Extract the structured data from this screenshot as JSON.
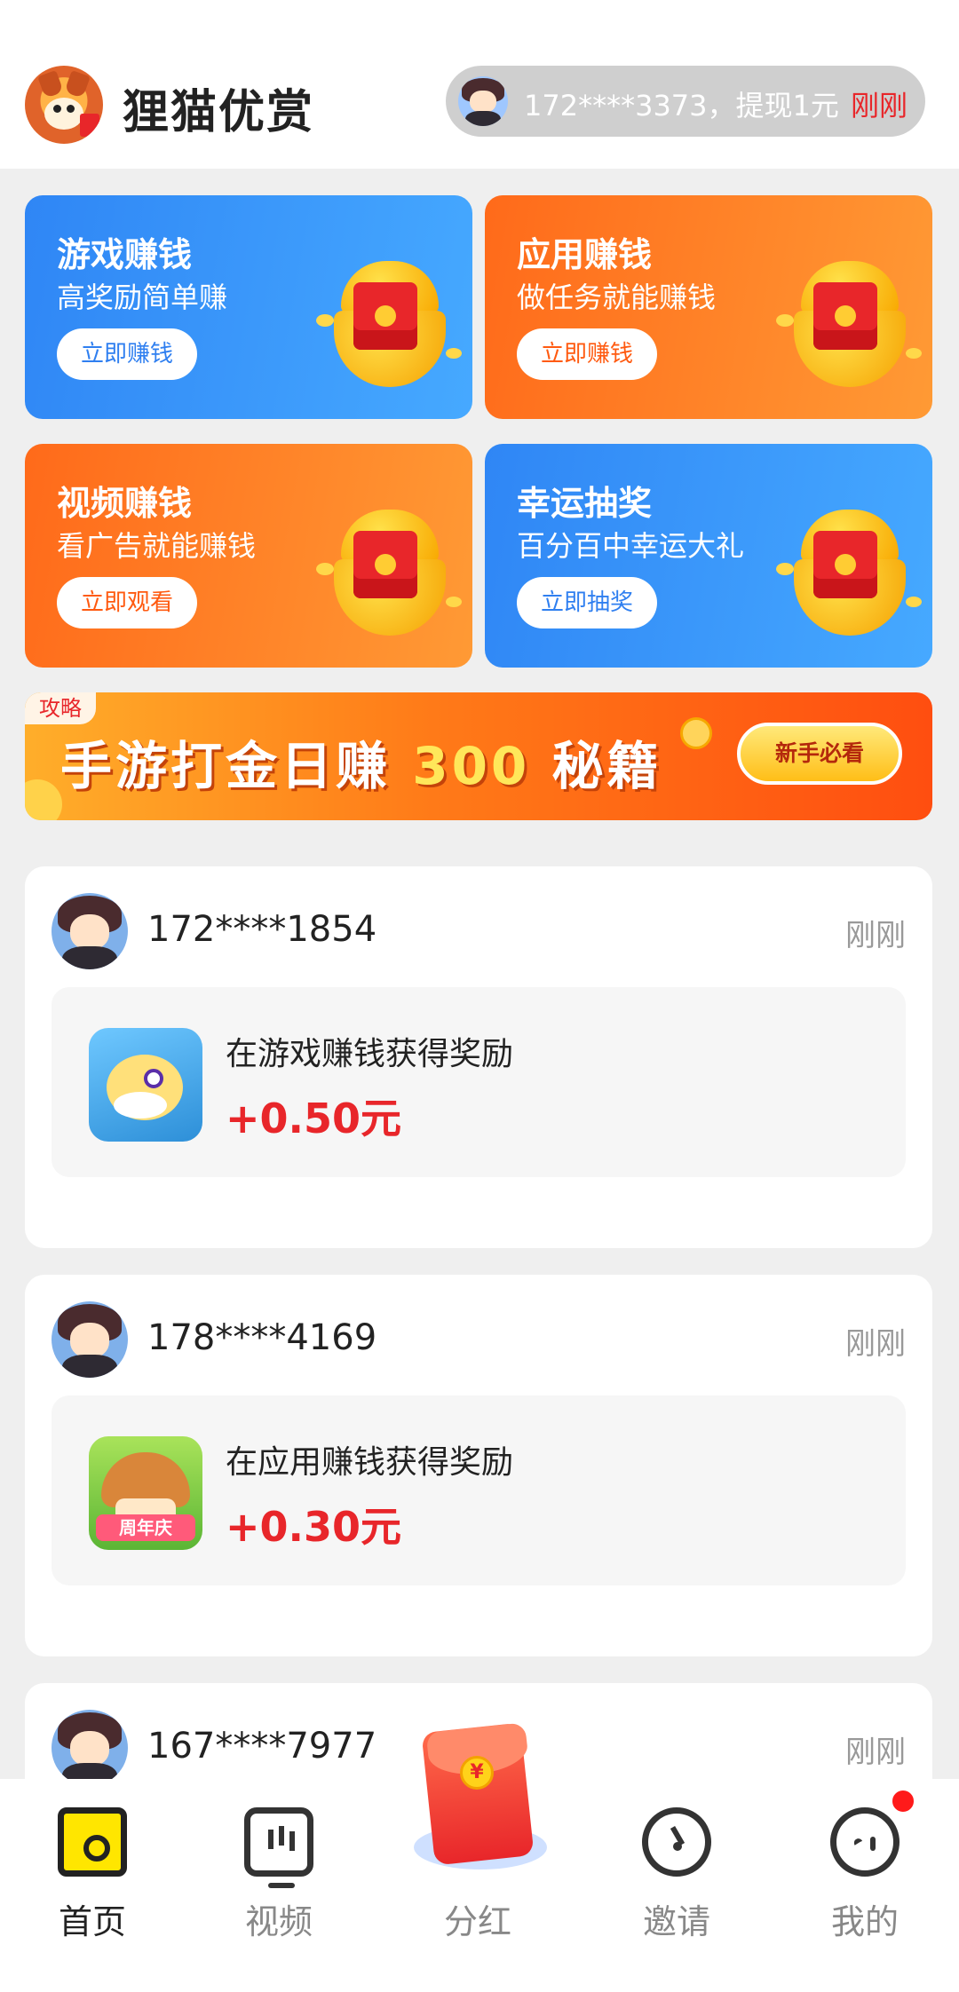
{
  "header": {
    "app_title": "狸猫优赏",
    "ticker_text": "172****3373，提现1元",
    "ticker_time": "刚刚"
  },
  "feature_cards": [
    {
      "title": "游戏赚钱",
      "subtitle": "高奖励简单赚",
      "button": "立即赚钱",
      "theme": "blue"
    },
    {
      "title": "应用赚钱",
      "subtitle": "做任务就能赚钱",
      "button": "立即赚钱",
      "theme": "orange"
    },
    {
      "title": "视频赚钱",
      "subtitle": "看广告就能赚钱",
      "button": "立即观看",
      "theme": "orange"
    },
    {
      "title": "幸运抽奖",
      "subtitle": "百分百中幸运大礼",
      "button": "立即抽奖",
      "theme": "blue"
    }
  ],
  "banner": {
    "tag": "攻略",
    "text_before": "手游打金日赚",
    "number": "300",
    "text_after": "秘籍",
    "button": "新手必看"
  },
  "feed": [
    {
      "user": "172****1854",
      "time": "刚刚",
      "desc": "在游戏赚钱获得奖励",
      "amount": "+0.50元",
      "icon": "pufferfish-game-icon"
    },
    {
      "user": "178****4169",
      "time": "刚刚",
      "desc": "在应用赚钱获得奖励",
      "amount": "+0.30元",
      "icon": "mushroom-app-icon",
      "icon_label": "周年庆"
    },
    {
      "user": "167****7977",
      "time": "刚刚"
    }
  ],
  "center_env": {
    "symbol": "¥"
  },
  "nav": [
    {
      "label": "首页",
      "icon": "home-icon",
      "active": true
    },
    {
      "label": "视频",
      "icon": "tv-icon",
      "active": false
    },
    {
      "label": "分红",
      "icon": "red-envelope-icon",
      "active": false
    },
    {
      "label": "邀请",
      "icon": "invite-icon",
      "active": false
    },
    {
      "label": "我的",
      "icon": "profile-icon",
      "active": false,
      "badge": true
    }
  ],
  "colors": {
    "blue": "#2f86f5",
    "orange": "#ff6a1a",
    "red": "#e8262a",
    "badge": "#ff1a1a"
  }
}
